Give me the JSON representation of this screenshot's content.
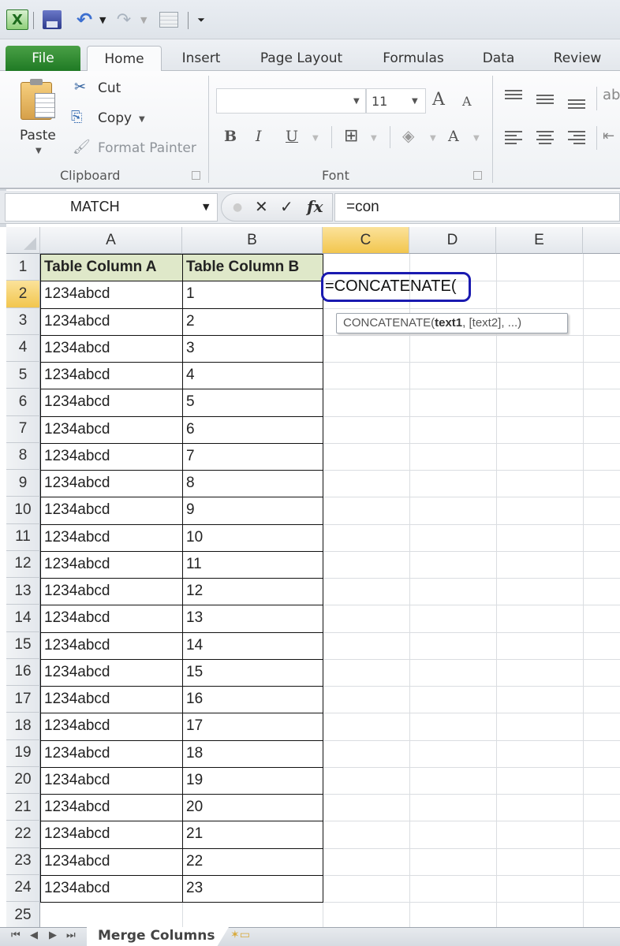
{
  "app": {
    "name": "Microsoft Excel"
  },
  "quick_access": {
    "icons": [
      "excel-logo-icon",
      "save-icon",
      "undo-icon",
      "redo-icon",
      "form-icon",
      "customize-icon"
    ]
  },
  "ribbon": {
    "tabs": [
      {
        "label": "File",
        "active": false
      },
      {
        "label": "Home",
        "active": true
      },
      {
        "label": "Insert",
        "active": false
      },
      {
        "label": "Page Layout",
        "active": false
      },
      {
        "label": "Formulas",
        "active": false
      },
      {
        "label": "Data",
        "active": false
      },
      {
        "label": "Review",
        "active": false
      }
    ],
    "clipboard": {
      "paste_label": "Paste",
      "cut_label": "Cut",
      "copy_label": "Copy",
      "format_painter_label": "Format Painter",
      "group_label": "Clipboard"
    },
    "font": {
      "font_name": "",
      "font_size": "11",
      "bold": "B",
      "italic": "I",
      "underline": "U",
      "grow": "A",
      "shrink": "A",
      "font_color": "A",
      "group_label": "Font"
    }
  },
  "formula_bar": {
    "name_box": "MATCH",
    "cancel_glyph": "✕",
    "enter_glyph": "✓",
    "fx_glyph": "fx",
    "formula": "=con"
  },
  "grid": {
    "columns": [
      "A",
      "B",
      "C",
      "D",
      "E"
    ],
    "selected_column": "C",
    "selected_row": 2,
    "rows": [
      "1",
      "2",
      "3",
      "4",
      "5",
      "6",
      "7",
      "8",
      "9",
      "10",
      "11",
      "12",
      "13",
      "14",
      "15",
      "16",
      "17",
      "18",
      "19",
      "20",
      "21",
      "22",
      "23",
      "24",
      "25"
    ],
    "header_row": {
      "A": "Table Column A",
      "B": "Table Column B"
    },
    "data": [
      [
        "1234abcd",
        "1"
      ],
      [
        "1234abcd",
        "2"
      ],
      [
        "1234abcd",
        "3"
      ],
      [
        "1234abcd",
        "4"
      ],
      [
        "1234abcd",
        "5"
      ],
      [
        "1234abcd",
        "6"
      ],
      [
        "1234abcd",
        "7"
      ],
      [
        "1234abcd",
        "8"
      ],
      [
        "1234abcd",
        "9"
      ],
      [
        "1234abcd",
        "10"
      ],
      [
        "1234abcd",
        "11"
      ],
      [
        "1234abcd",
        "12"
      ],
      [
        "1234abcd",
        "13"
      ],
      [
        "1234abcd",
        "14"
      ],
      [
        "1234abcd",
        "15"
      ],
      [
        "1234abcd",
        "16"
      ],
      [
        "1234abcd",
        "17"
      ],
      [
        "1234abcd",
        "18"
      ],
      [
        "1234abcd",
        "19"
      ],
      [
        "1234abcd",
        "20"
      ],
      [
        "1234abcd",
        "21"
      ],
      [
        "1234abcd",
        "22"
      ],
      [
        "1234abcd",
        "23"
      ]
    ],
    "editing_cell": {
      "ref": "C2",
      "text": "=CONCATENATE("
    },
    "tooltip": {
      "fn": "CONCATENATE(",
      "arg_bold": "text1",
      "rest": ", [text2], ...)"
    }
  },
  "sheets": {
    "nav": [
      "⏮",
      "◀",
      "▶",
      "⏭"
    ],
    "tabs": [
      "Merge Columns"
    ],
    "new_sheet_icon": "insert-sheet-icon"
  },
  "colors": {
    "file_tab": "#2a8a2e",
    "header_fill": "#dfe8c9",
    "selection_header": "#f2c64e",
    "annotation_circle": "#1a1ab0"
  }
}
